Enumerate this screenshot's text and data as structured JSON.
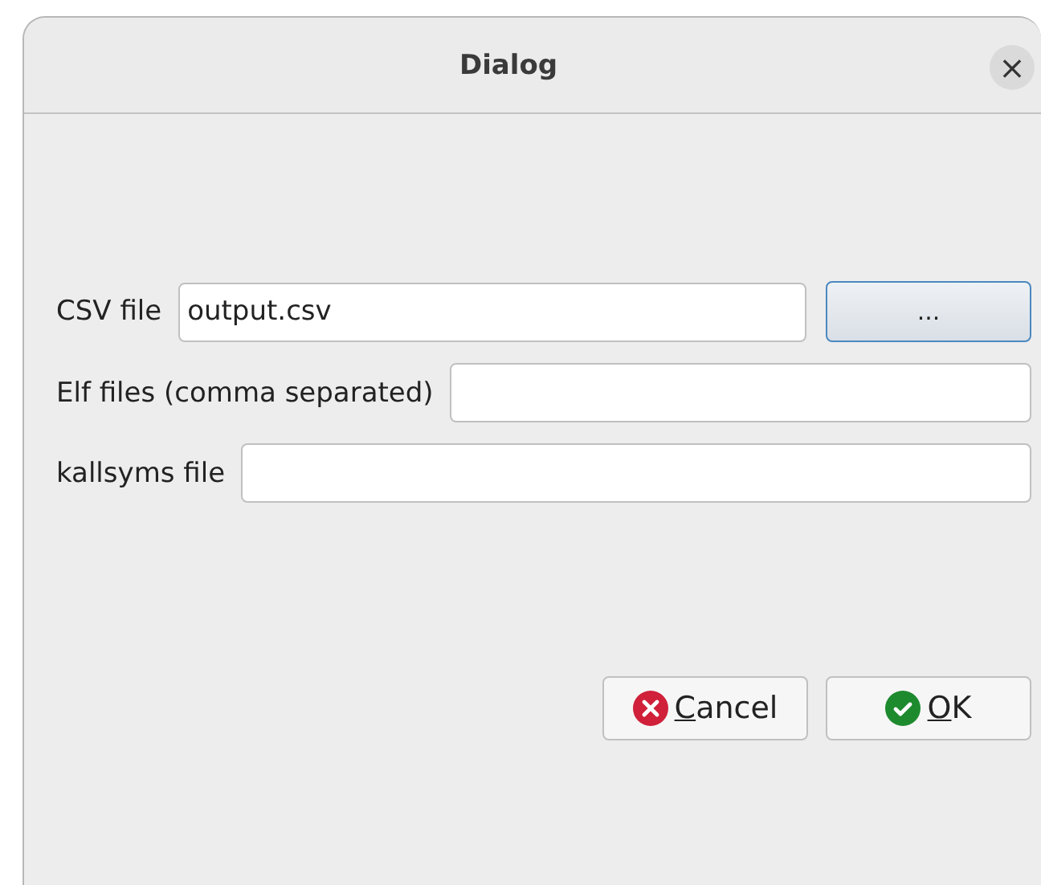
{
  "window": {
    "title": "Dialog",
    "close": "×"
  },
  "fields": [
    {
      "label": "CSV file",
      "value": "output.csv",
      "browse": "..."
    },
    {
      "label": "Elf files (comma separated)"
    },
    {
      "label": "kallsyms file"
    }
  ],
  "buttons": [
    {
      "kind": "cancel",
      "label": "Cancel",
      "underline_first": true
    },
    {
      "kind": "ok",
      "label": "OK",
      "underline_first": true
    }
  ]
}
